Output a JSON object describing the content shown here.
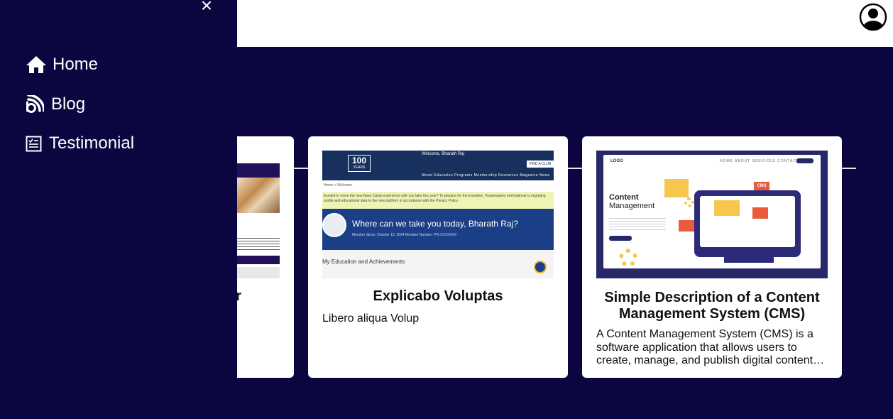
{
  "sidebar": {
    "close_glyph": "×",
    "items": [
      {
        "label": "Home",
        "icon": "home-icon"
      },
      {
        "label": "Blog",
        "icon": "blog-icon"
      },
      {
        "label": "Testimonial",
        "icon": "testimonial-icon"
      }
    ]
  },
  "header": {
    "profile_icon": "user-circle-icon"
  },
  "cards": [
    {
      "title": "r",
      "description": ""
    },
    {
      "title": "Explicabo Voluptas",
      "description": "Libero aliqua Volup",
      "image": {
        "badge_number": "100",
        "badge_sub": "YEARS",
        "welcome": "Welcome, Bharath Raj",
        "nav_text": "About   Education Programs   Membership   Resources   Magazine   News",
        "find_club": "FIND A CLUB",
        "breadcrumb": "Home > Welcome",
        "notice": "Excited to move the new Base Camp experience with you later this year? To prepare for the transition, Toastmasters International is migrating profile and educational data to the new platform in accordance with the Privacy Policy.",
        "hero_text": "Where can we take you today, Bharath Raj?",
        "hero_sub": "Member Since: October 10, 2024      Member Number: PN-XXXXXXX",
        "section_title": "My Education and Achievements"
      }
    },
    {
      "title": "Simple Description of a Content Management System (CMS)",
      "description": "A Content Management System (CMS) is a software application that allows users to create, manage, and publish digital content…",
      "image": {
        "logo": "LOGO",
        "nav": "HOME   ABOUT   SERVICES   CONTACT",
        "heading_line1": "Content",
        "heading_line2": "Management",
        "tag": "CMS"
      }
    }
  ]
}
